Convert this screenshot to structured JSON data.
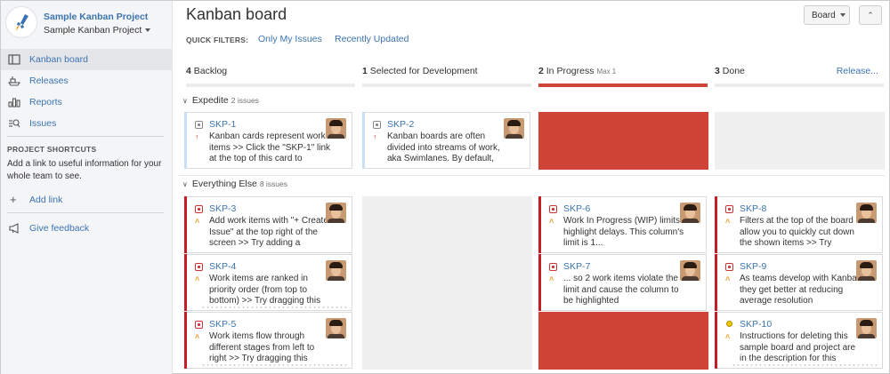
{
  "colors": {
    "link": "#3b73af",
    "over_limit": "#d04437",
    "flag_red": "#d04437",
    "expedite_stripe": "#c8e1f7",
    "else_stripe": "#c41d25"
  },
  "project": {
    "name": "Sample Kanban Project",
    "selector": "Sample Kanban Project",
    "avatar_icon": "rocket-icon"
  },
  "nav": [
    {
      "label": "Kanban board",
      "icon": "board-icon",
      "active": true
    },
    {
      "label": "Releases",
      "icon": "ship-icon"
    },
    {
      "label": "Reports",
      "icon": "chart-icon"
    },
    {
      "label": "Issues",
      "icon": "issues-search-icon"
    }
  ],
  "shortcuts": {
    "title": "PROJECT SHORTCUTS",
    "text": "Add a link to useful information for your whole team to see.",
    "add_link": "Add link",
    "feedback": "Give feedback"
  },
  "header": {
    "title": "Kanban board",
    "board_button": "Board",
    "quick_filters_label": "QUICK FILTERS:",
    "filters": [
      "Only My Issues",
      "Recently Updated"
    ]
  },
  "columns": [
    {
      "count": "4",
      "name": "Backlog",
      "max": ""
    },
    {
      "count": "1",
      "name": "Selected for Development",
      "max": ""
    },
    {
      "count": "2",
      "name": "In Progress",
      "max": "Max 1",
      "over_limit": true
    },
    {
      "count": "3",
      "name": "Done",
      "max": "",
      "action": "Release..."
    }
  ],
  "swimlanes": [
    {
      "name": "Expedite",
      "count": "2 issues"
    },
    {
      "name": "Everything Else",
      "count": "8 issues"
    }
  ],
  "cards": {
    "skp1": {
      "key": "SKP-1",
      "summary": "Kanban cards represent work items >> Click the \"SKP-1\" link at the top of this card to"
    },
    "skp2": {
      "key": "SKP-2",
      "summary": "Kanban boards are often divided into streams of work, aka Swimlanes. By default,"
    },
    "skp3": {
      "key": "SKP-3",
      "summary": "Add work items with \"+ Create Issue\" at the top right of the screen >> Try adding a"
    },
    "skp4": {
      "key": "SKP-4",
      "summary": "Work items are ranked in priority order (from top to bottom) >> Try dragging this"
    },
    "skp5": {
      "key": "SKP-5",
      "summary": "Work items flow through different stages from left to right >> Try dragging this"
    },
    "skp6": {
      "key": "SKP-6",
      "summary": "Work In Progress (WIP) limits highlight delays. This column's limit is 1..."
    },
    "skp7": {
      "key": "SKP-7",
      "summary": "... so 2 work items violate the limit and cause the column to be highlighted"
    },
    "skp8": {
      "key": "SKP-8",
      "summary": "Filters at the top of the board allow you to quickly cut down the shown items >> Try"
    },
    "skp9": {
      "key": "SKP-9",
      "summary": "As teams develop with Kanban they get better at reducing average resolution"
    },
    "skp10": {
      "key": "SKP-10",
      "summary": "Instructions for deleting this sample board and project are in the description for this"
    }
  }
}
